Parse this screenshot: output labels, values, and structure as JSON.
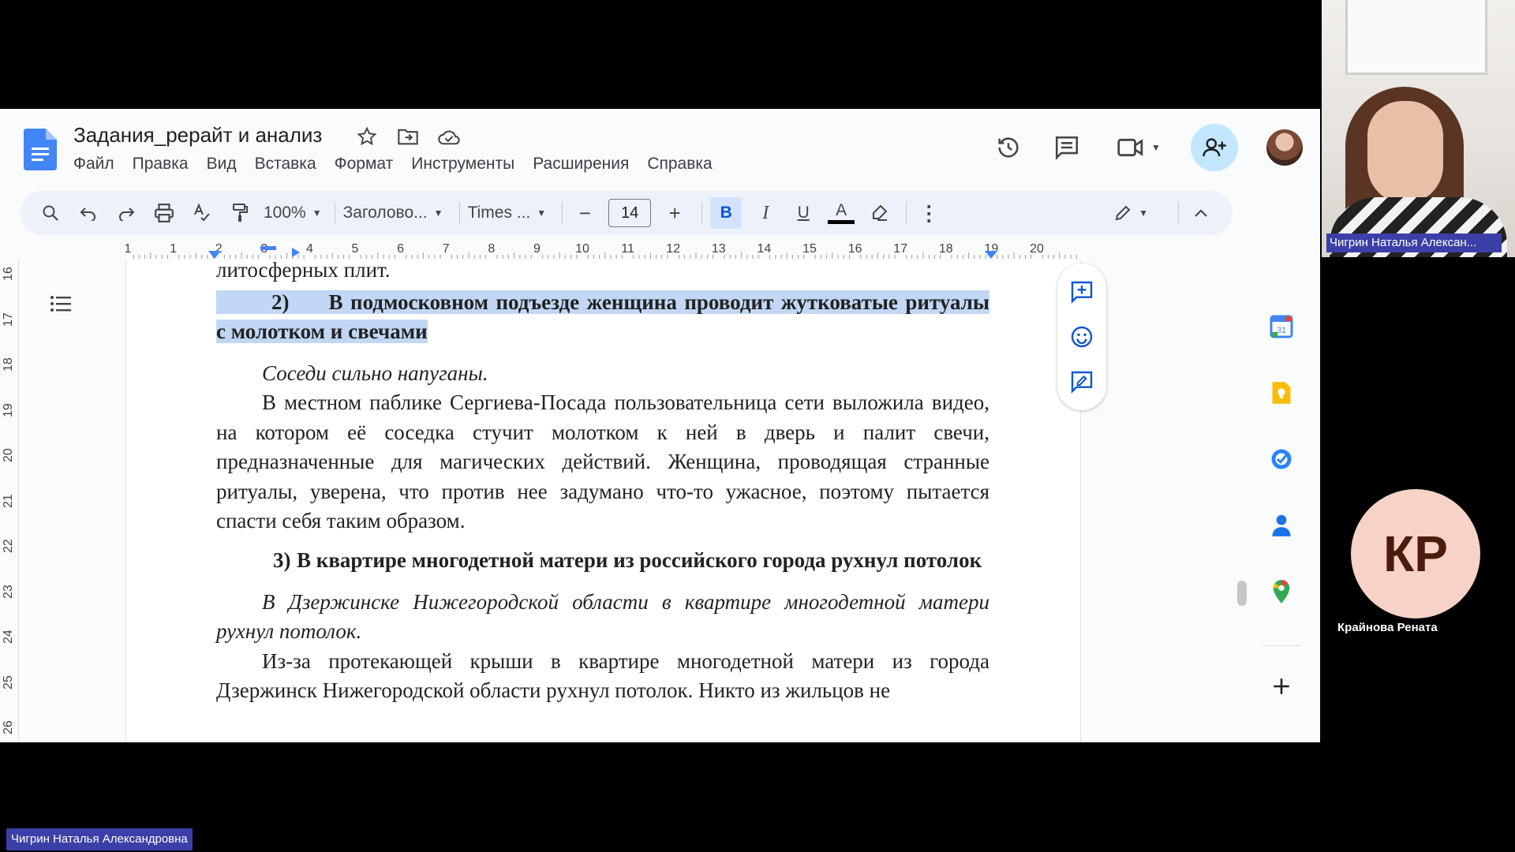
{
  "doc": {
    "title": "Задания_рерайт и анализ",
    "menu": [
      "Файл",
      "Правка",
      "Вид",
      "Вставка",
      "Формат",
      "Инструменты",
      "Расширения",
      "Справка"
    ]
  },
  "toolbar": {
    "zoom": "100%",
    "style": "Заголово...",
    "font": "Times ...",
    "font_size": "14",
    "minus": "−",
    "plus": "+",
    "bold": "B",
    "italic": "I",
    "underline": "U",
    "text_color_letter": "A"
  },
  "ruler": {
    "numbers": [
      "1",
      "1",
      "2",
      "3",
      "4",
      "5",
      "6",
      "7",
      "8",
      "9",
      "10",
      "11",
      "12",
      "13",
      "14",
      "15",
      "16",
      "17",
      "18",
      "19",
      "20"
    ]
  },
  "vruler": {
    "numbers": [
      "16",
      "17",
      "18",
      "19",
      "20",
      "21",
      "22",
      "23",
      "24",
      "25",
      "26"
    ]
  },
  "content": {
    "p0": "литосферных плит.",
    "h2_num": "2)",
    "h2_text": "В подмосковном подъезде женщина проводит жутковатые ритуалы с молотком и свечами",
    "sub2": "Соседи сильно напуганы.",
    "body2": "В местном паблике Сергиева-Посада пользовательница сети выложила видео, на котором её соседка стучит молотком к ней в дверь и палит свечи, предназначенные для магических действий. Женщина, проводящая странные ритуалы, уверена, что против нее задумано что-то ужасное, поэтому пытается спасти себя таким образом.",
    "h3_num": "3)",
    "h3_text": "В квартире многодетной матери из российского города рухнул потолок",
    "sub3": "В Дзержинске Нижегородской области в квартире многодетной матери рухнул потолок.",
    "body3": "Из-за протекающей крыши в квартире многодетной матери из города Дзержинск Нижегородской области рухнул потолок. Никто из жильцов не"
  },
  "participants": {
    "cam_name": "Чигрин Наталья Алексан...",
    "kp_initials": "КР",
    "kp_name": "Крайнова Рената",
    "presenter_name": "Чигрин Наталья Александровна"
  },
  "side_panel": {
    "calendar_day": "31"
  },
  "colors": {
    "docs_blue": "#4285f4",
    "highlight": "#c2d7f5",
    "share_bg": "#c2e7ff",
    "name_tag": "#3d3fa8",
    "kp_bg": "#f6d3c6"
  }
}
